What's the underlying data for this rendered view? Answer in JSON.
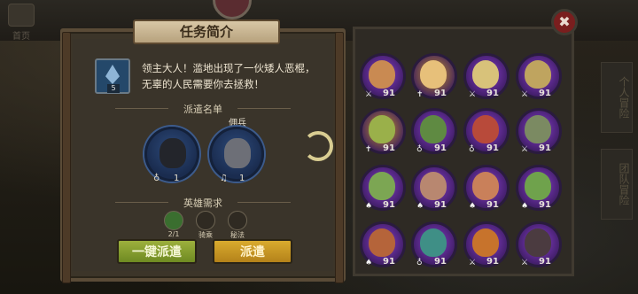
{
  "background": {
    "home_label": "首页",
    "side_tabs": [
      "个人冒险",
      "团队冒险"
    ]
  },
  "mission": {
    "title": "任务简介",
    "task_level": "5",
    "description_line1": "领主大人！滥地出现了一伙矮人恶棍，",
    "description_line2": "无辜的人民需要你去拯救！",
    "dispatch_header": "派遣名单",
    "dispatch_slots": [
      {
        "caption": "",
        "count": "1",
        "color": "#3f5f95",
        "face": "#23252b"
      },
      {
        "caption": "佣兵",
        "count": "1",
        "color": "#3f5f95",
        "face": "#6d6f77"
      }
    ],
    "requirements_header": "英雄需求",
    "requirements": [
      {
        "label": "2/1",
        "icon": "green-gem-icon"
      },
      {
        "label": "骑乘",
        "icon": "mount-icon"
      },
      {
        "label": "秘法",
        "icon": "arcane-icon"
      }
    ],
    "auto_dispatch_label": "一键派遣",
    "dispatch_label": "派遣"
  },
  "close_label": "✖",
  "heroes": [
    {
      "level": "91",
      "cls": "⚔",
      "ring": "#8a3fcf",
      "face": "#c98a52"
    },
    {
      "level": "91",
      "cls": "✝",
      "ring": "#cf9a2a",
      "face": "#e7c07a"
    },
    {
      "level": "91",
      "cls": "⚔",
      "ring": "#8a3fcf",
      "face": "#d8c27a"
    },
    {
      "level": "91",
      "cls": "⚔",
      "ring": "#8a3fcf",
      "face": "#bfa45f"
    },
    {
      "level": "91",
      "cls": "✝",
      "ring": "#cf9a2a",
      "face": "#9ab04a"
    },
    {
      "level": "91",
      "cls": "♁",
      "ring": "#8a3fcf",
      "face": "#5f8a42"
    },
    {
      "level": "91",
      "cls": "♁",
      "ring": "#8a3fcf",
      "face": "#b84a3a"
    },
    {
      "level": "91",
      "cls": "⚔",
      "ring": "#8a3fcf",
      "face": "#7b8a62"
    },
    {
      "level": "91",
      "cls": "♠",
      "ring": "#8a3fcf",
      "face": "#7ca653"
    },
    {
      "level": "91",
      "cls": "♠",
      "ring": "#8a3fcf",
      "face": "#b88770"
    },
    {
      "level": "91",
      "cls": "♠",
      "ring": "#8a3fcf",
      "face": "#c9805a"
    },
    {
      "level": "91",
      "cls": "♠",
      "ring": "#8a3fcf",
      "face": "#6fa24c"
    },
    {
      "level": "91",
      "cls": "♠",
      "ring": "#8a3fcf",
      "face": "#b5643a"
    },
    {
      "level": "91",
      "cls": "♁",
      "ring": "#8a3fcf",
      "face": "#3f8f86"
    },
    {
      "level": "91",
      "cls": "⚔",
      "ring": "#8a3fcf",
      "face": "#c7732c"
    },
    {
      "level": "91",
      "cls": "⚔",
      "ring": "#8a3fcf",
      "face": "#4b3b40"
    }
  ]
}
